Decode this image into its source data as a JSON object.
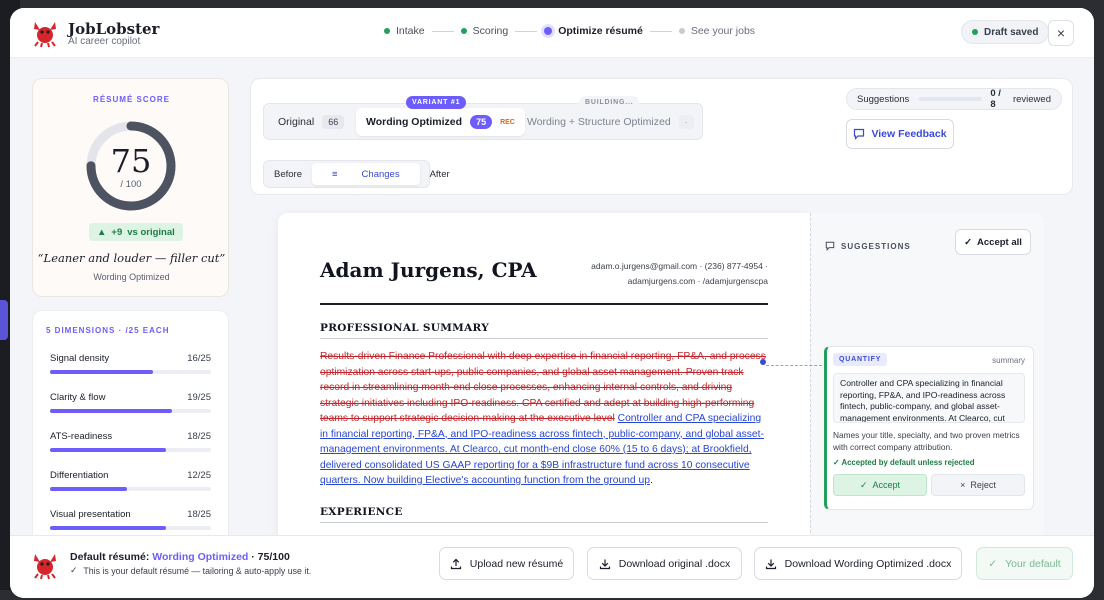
{
  "header": {
    "brand": "JobLobster",
    "brand_sub": "AI career copilot",
    "steps": [
      "Intake",
      "Scoring",
      "Optimize résumé",
      "See your jobs"
    ],
    "draft": "Draft saved",
    "close": "×"
  },
  "score": {
    "title": "RÉSUMÉ SCORE",
    "value": 75,
    "max_label": "/ 100",
    "delta": "+9",
    "delta_suffix": "vs original",
    "tagline": "“Leaner and louder — filler cut”",
    "variant_name": "Wording Optimized"
  },
  "dimensions": {
    "title": "5 DIMENSIONS · /25 EACH",
    "items": [
      {
        "label": "Signal density",
        "value": "16/25",
        "score": 16
      },
      {
        "label": "Clarity & flow",
        "value": "19/25",
        "score": 19
      },
      {
        "label": "ATS-readiness",
        "value": "18/25",
        "score": 18
      },
      {
        "label": "Differentiation",
        "value": "12/25",
        "score": 12
      },
      {
        "label": "Visual presentation",
        "value": "18/25",
        "score": 18
      }
    ]
  },
  "tabs": {
    "original": {
      "label": "Original",
      "count": "66"
    },
    "wording": {
      "label": "Wording Optimized",
      "count": "75",
      "badge": "VARIANT #1",
      "rec": "REC"
    },
    "structure": {
      "label": "Wording + Structure Optimized",
      "count": "·",
      "badge": "BUILDING..."
    }
  },
  "views": [
    "Before",
    "Changes",
    "After"
  ],
  "suggestions_progress": {
    "label": "Suggestions",
    "value": "0 / 8",
    "suffix": "reviewed",
    "reviewed": 0,
    "total": 8
  },
  "view_feedback": "View Feedback",
  "resume": {
    "name": "Adam Jurgens, CPA",
    "contact_line1": "adam.o.jurgens@gmail.com · (236) 877-4954 ·",
    "contact_line2": "adamjurgens.com · /adamjurgenscpa",
    "section_summary": "PROFESSIONAL SUMMARY",
    "deleted": "Results-driven Finance Professional with deep expertise in financial reporting, FP&A, and process optimization across start-ups, public companies, and global asset management. Proven track record in streamlining month-end close processes, enhancing internal controls, and driving strategic initiatives including IPO-readiness. CPA certified and adept at building high-performing teams to support strategic decision-making at the executive level",
    "inserted": "Controller and CPA specializing in financial reporting, FP&A, and IPO-readiness across fintech, public-company, and global asset-management environments. At Clearco, cut month-end close 60% (15 to 6 days); at Brookfield, delivered consolidated US GAAP reporting for a $9B infrastructure fund across 10 consecutive quarters. Now building Elective's accounting function from the ground up",
    "trailing": ".",
    "section_experience": "EXPERIENCE"
  },
  "suggestions_panel": {
    "title": "SUGGESTIONS",
    "accept_all": "Accept all",
    "card": {
      "tag": "QUANTIFY",
      "type": "summary",
      "text": "Controller and CPA specializing in financial reporting, FP&A, and IPO-readiness across fintech, public-company, and global asset-management environments. At Clearco, cut",
      "reason": "Names your title, specialty, and two proven metrics with correct company attribution.",
      "default_note": "Accepted by default unless rejected",
      "accept": "Accept",
      "reject": "Reject"
    }
  },
  "footer": {
    "prefix": "Default résumé:",
    "variant": "Wording Optimized",
    "score": "· 75/100",
    "note": "This is your default résumé — tailoring & auto-apply use it.",
    "upload": "Upload new résumé",
    "download_original": "Download original .docx",
    "download_variant": "Download Wording Optimized .docx",
    "your_default": "Your default"
  },
  "colors": {
    "accent": "#6d5dfc",
    "success": "#22a05b",
    "deleted": "#c0262d",
    "inserted": "#2845d3"
  }
}
